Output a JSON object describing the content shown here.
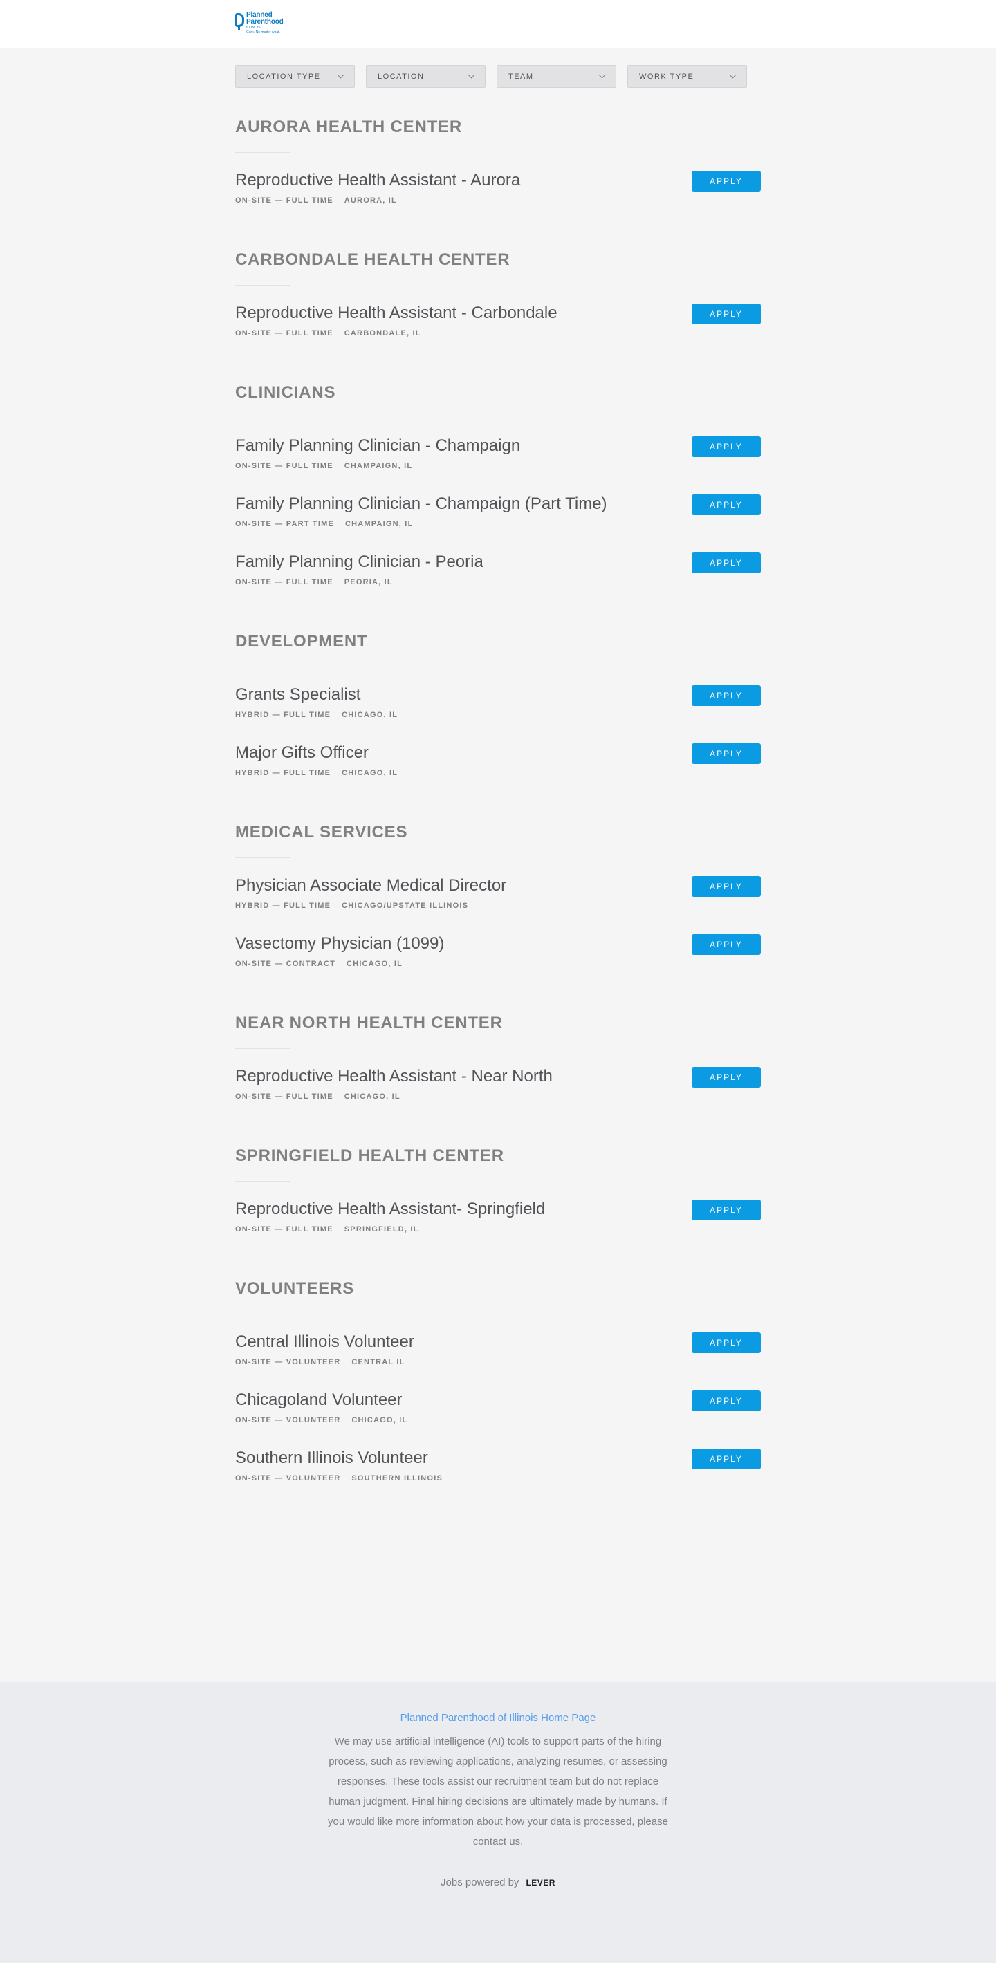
{
  "brand": {
    "logo_line1": "Planned",
    "logo_line2": "Parenthood",
    "logo_line3": "ILLINOIS",
    "logo_tagline": "Care. No matter what."
  },
  "filters": [
    {
      "label": "LOCATION TYPE"
    },
    {
      "label": "LOCATION"
    },
    {
      "label": "TEAM"
    },
    {
      "label": "WORK TYPE"
    }
  ],
  "apply_label": "APPLY",
  "groups": [
    {
      "title": "AURORA HEALTH CENTER",
      "postings": [
        {
          "title": "Reproductive Health Assistant - Aurora",
          "commitment": "ON-SITE — FULL TIME",
          "location": "AURORA, IL"
        }
      ]
    },
    {
      "title": "CARBONDALE HEALTH CENTER",
      "postings": [
        {
          "title": "Reproductive Health Assistant - Carbondale",
          "commitment": "ON-SITE — FULL TIME",
          "location": "CARBONDALE, IL"
        }
      ]
    },
    {
      "title": "CLINICIANS",
      "postings": [
        {
          "title": "Family Planning Clinician - Champaign",
          "commitment": "ON-SITE — FULL TIME",
          "location": "CHAMPAIGN, IL"
        },
        {
          "title": "Family Planning Clinician - Champaign (Part Time)",
          "commitment": "ON-SITE — PART TIME",
          "location": "CHAMPAIGN, IL"
        },
        {
          "title": "Family Planning Clinician - Peoria",
          "commitment": "ON-SITE — FULL TIME",
          "location": "PEORIA, IL"
        }
      ]
    },
    {
      "title": "DEVELOPMENT",
      "postings": [
        {
          "title": "Grants Specialist",
          "commitment": "HYBRID — FULL TIME",
          "location": "CHICAGO, IL"
        },
        {
          "title": "Major Gifts Officer",
          "commitment": "HYBRID — FULL TIME",
          "location": "CHICAGO, IL"
        }
      ]
    },
    {
      "title": "MEDICAL SERVICES",
      "postings": [
        {
          "title": "Physician Associate Medical Director",
          "commitment": "HYBRID — FULL TIME",
          "location": "CHICAGO/UPSTATE ILLINOIS"
        },
        {
          "title": "Vasectomy Physician (1099)",
          "commitment": "ON-SITE — CONTRACT",
          "location": "CHICAGO, IL"
        }
      ]
    },
    {
      "title": "NEAR NORTH HEALTH CENTER",
      "postings": [
        {
          "title": "Reproductive Health Assistant - Near North",
          "commitment": "ON-SITE — FULL TIME",
          "location": "CHICAGO, IL"
        }
      ]
    },
    {
      "title": "SPRINGFIELD HEALTH CENTER",
      "postings": [
        {
          "title": "Reproductive Health Assistant- Springfield",
          "commitment": "ON-SITE — FULL TIME",
          "location": "SPRINGFIELD, IL"
        }
      ]
    },
    {
      "title": "VOLUNTEERS",
      "postings": [
        {
          "title": "Central Illinois Volunteer",
          "commitment": "ON-SITE — VOLUNTEER",
          "location": "CENTRAL IL"
        },
        {
          "title": "Chicagoland Volunteer",
          "commitment": "ON-SITE — VOLUNTEER",
          "location": "CHICAGO, IL"
        },
        {
          "title": "Southern Illinois Volunteer",
          "commitment": "ON-SITE — VOLUNTEER",
          "location": "SOUTHERN ILLINOIS"
        }
      ]
    }
  ],
  "footer": {
    "home_link": "Planned Parenthood of Illinois Home Page",
    "note": "We may use artificial intelligence (AI) tools to support parts of the hiring process, such as reviewing applications, analyzing resumes, or assessing responses. These tools assist our recruitment team but do not replace human judgment. Final hiring decisions are ultimately made by humans. If you would like more information about how your data is processed, please contact us.",
    "powered_by": "Jobs powered by",
    "lever": "LEVER"
  },
  "colors": {
    "apply_button": "#0a9be3",
    "footer_link": "#579eee",
    "brand_blue": "#0c7bc0"
  }
}
